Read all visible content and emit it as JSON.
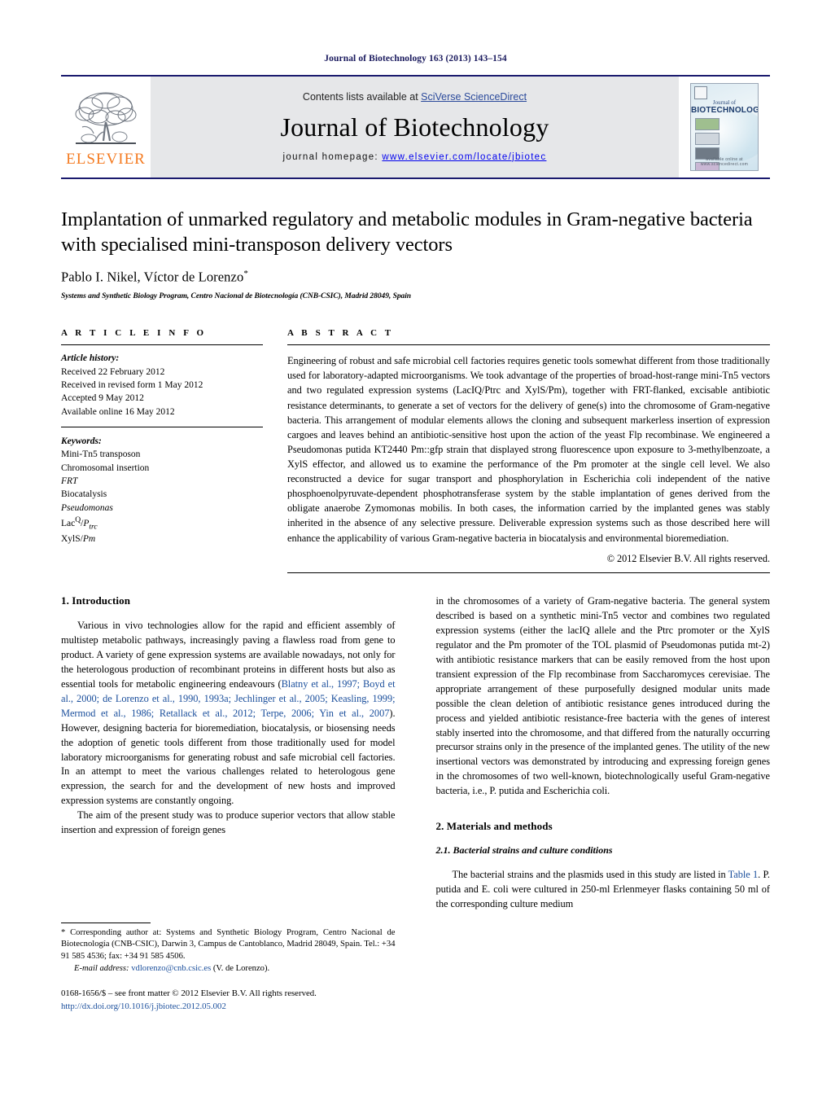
{
  "running_head": "Journal of Biotechnology 163 (2013) 143–154",
  "masthead": {
    "contents_prefix": "Contents lists available at ",
    "sciencedirect": "SciVerse ScienceDirect",
    "journal_name": "Journal of Biotechnology",
    "homepage_label": "journal homepage:",
    "homepage_url": "www.elsevier.com/locate/jbiotec",
    "publisher_logo_text": "ELSEVIER",
    "publisher_logo_icon": "elsevier-tree-icon",
    "cover": {
      "title_line1": "Journal of",
      "title_line2": "BIOTECHNOLOGY",
      "footer": "available online at www.sciencedirect.com"
    },
    "colors": {
      "band": "#e6e7e9",
      "rule": "#1a1a6e",
      "link": "#2b4a9b",
      "elsevier_orange": "#f47a20"
    }
  },
  "article": {
    "title": "Implantation of unmarked regulatory and metabolic modules in Gram-negative bacteria with specialised mini-transposon delivery vectors",
    "authors": "Pablo I. Nikel, Víctor de Lorenzo",
    "author_star": "*",
    "affiliation": "Systems and Synthetic Biology Program, Centro Nacional de Biotecnología (CNB-CSIC), Madrid 28049, Spain"
  },
  "article_info": {
    "heading": "A R T I C L E    I N F O",
    "history_label": "Article history:",
    "history": [
      "Received 22 February 2012",
      "Received in revised form 1 May 2012",
      "Accepted 9 May 2012",
      "Available online 16 May 2012"
    ],
    "keywords_label": "Keywords:",
    "keywords": [
      "Mini-Tn5 transposon",
      "Chromosomal insertion",
      "FRT",
      "Biocatalysis",
      "Pseudomonas",
      "LacIQ/Ptrc",
      "XylS/Pm"
    ]
  },
  "abstract": {
    "heading": "A B S T R A C T",
    "text": "Engineering of robust and safe microbial cell factories requires genetic tools somewhat different from those traditionally used for laboratory-adapted microorganisms. We took advantage of the properties of broad-host-range mini-Tn5 vectors and two regulated expression systems (LacIQ/Ptrc and XylS/Pm), together with FRT-flanked, excisable antibiotic resistance determinants, to generate a set of vectors for the delivery of gene(s) into the chromosome of Gram-negative bacteria. This arrangement of modular elements allows the cloning and subsequent markerless insertion of expression cargoes and leaves behind an antibiotic-sensitive host upon the action of the yeast Flp recombinase. We engineered a Pseudomonas putida KT2440 Pm::gfp strain that displayed strong fluorescence upon exposure to 3-methylbenzoate, a XylS effector, and allowed us to examine the performance of the Pm promoter at the single cell level. We also reconstructed a device for sugar transport and phosphorylation in Escherichia coli independent of the native phosphoenolpyruvate-dependent phosphotransferase system by the stable implantation of genes derived from the obligate anaerobe Zymomonas mobilis. In both cases, the information carried by the implanted genes was stably inherited in the absence of any selective pressure. Deliverable expression systems such as those described here will enhance the applicability of various Gram-negative bacteria in biocatalysis and environmental bioremediation.",
    "copyright": "© 2012 Elsevier B.V. All rights reserved."
  },
  "sections": {
    "introduction_heading": "1.  Introduction",
    "intro_p1": "Various in vivo technologies allow for the rapid and efficient assembly of multistep metabolic pathways, increasingly paving a flawless road from gene to product. A variety of gene expression systems are available nowadays, not only for the heterologous production of recombinant proteins in different hosts but also as essential tools for metabolic engineering endeavours (",
    "intro_p1_refs": "Blatny et al., 1997; Boyd et al., 2000; de Lorenzo et al., 1990, 1993a; Jechlinger et al., 2005; Keasling, 1999; Mermod et al., 1986; Retallack et al., 2012; Terpe, 2006; Yin et al., 2007",
    "intro_p1_tail": "). However, designing bacteria for bioremediation, biocatalysis, or biosensing needs the adoption of genetic tools different from those traditionally used for model laboratory microorganisms for generating robust and safe microbial cell factories. In an attempt to meet the various challenges related to heterologous gene expression, the search for and the development of new hosts and improved expression systems are constantly ongoing.",
    "intro_p2_left": "The aim of the present study was to produce superior vectors that allow stable insertion and expression of foreign genes",
    "intro_p2_right": "in the chromosomes of a variety of Gram-negative bacteria. The general system described is based on a synthetic mini-Tn5 vector and combines two regulated expression systems (either the lacIQ allele and the Ptrc promoter or the XylS regulator and the Pm promoter of the TOL plasmid of Pseudomonas putida mt-2) with antibiotic resistance markers that can be easily removed from the host upon transient expression of the Flp recombinase from Saccharomyces cerevisiae. The appropriate arrangement of these purposefully designed modular units made possible the clean deletion of antibiotic resistance genes introduced during the process and yielded antibiotic resistance-free bacteria with the genes of interest stably inserted into the chromosome, and that differed from the naturally occurring precursor strains only in the presence of the implanted genes. The utility of the new insertional vectors was demonstrated by introducing and expressing foreign genes in the chromosomes of two well-known, biotechnologically useful Gram-negative bacteria, i.e., P. putida and Escherichia coli.",
    "materials_heading": "2.  Materials and methods",
    "subsection_heading": "2.1.  Bacterial strains and culture conditions",
    "materials_p1_a": "The bacterial strains and the plasmids used in this study are listed in ",
    "materials_table_link": "Table 1",
    "materials_p1_b": ". P. putida and E. coli were cultured in 250-ml Erlenmeyer flasks containing 50 ml of the corresponding culture medium"
  },
  "footnote": {
    "corresponding": "* Corresponding author at: Systems and Synthetic Biology Program, Centro Nacional de Biotecnología (CNB-CSIC), Darwin 3, Campus de Cantoblanco, Madrid 28049, Spain. Tel.: +34 91 585 4536; fax: +34 91 585 4506.",
    "email_label": "E-mail address:",
    "email": "vdlorenzo@cnb.csic.es",
    "email_owner": "(V. de Lorenzo).",
    "issn_line": "0168-1656/$ – see front matter © 2012 Elsevier B.V. All rights reserved.",
    "doi": "http://dx.doi.org/10.1016/j.jbiotec.2012.05.002"
  }
}
